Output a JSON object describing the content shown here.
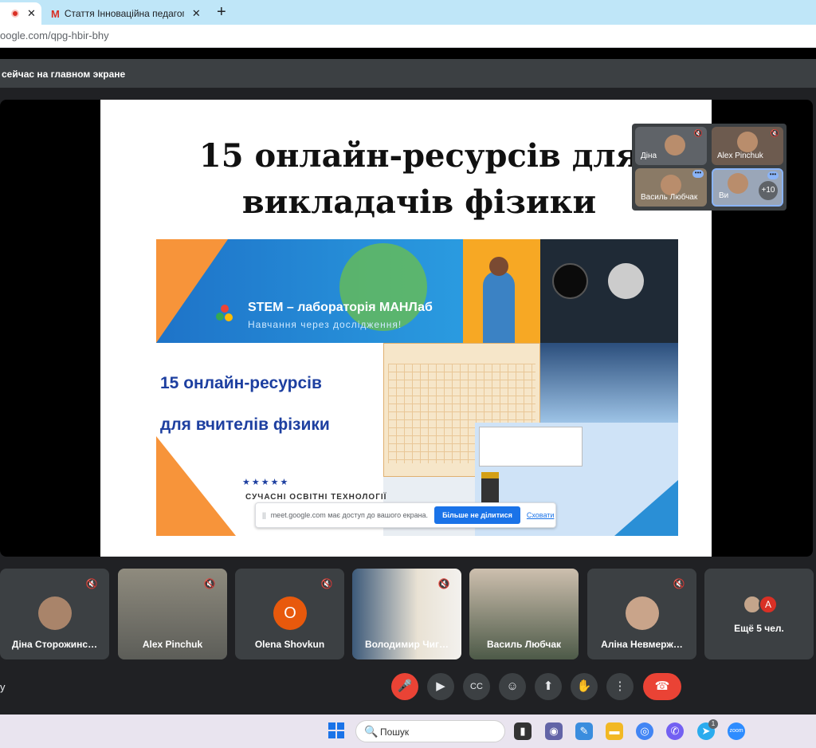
{
  "browser": {
    "tabs": [
      {
        "label": "",
        "close": "✕",
        "recording": true
      },
      {
        "label": "Стаття Інноваційна педагогіка ·",
        "close": "✕",
        "icon": "gmail-icon"
      }
    ],
    "new_tab": "+",
    "url": "oogle.com/qpg-hbir-bhy"
  },
  "meet": {
    "presenting_banner": "сейчас на главном экране",
    "slide": {
      "title_line1": "15 онлайн-ресурсів для",
      "title_line2": "викладачів фізики",
      "stem_title": "STEM – лабораторія МАНЛаб",
      "stem_subtitle": "Навчання через дослідження!",
      "big_line1": "15 онлайн-ресурсів",
      "big_line2": "для вчителів фізики",
      "edu_footer": "СУЧАСНІ ОСВІТНІ ТЕХНОЛОГІЇ",
      "stars": "★★★★★"
    },
    "share_notice": {
      "text": "meet.google.com має доступ до вашого екрана.",
      "stop_button": "Більше не ділитися",
      "hide_link": "Сховати"
    },
    "pip_tiles": [
      {
        "name": "Діна",
        "muted": true
      },
      {
        "name": "Alex Pinchuk",
        "muted": true
      },
      {
        "name": "Василь Любчак",
        "more": true
      },
      {
        "name": "Ви",
        "more": true,
        "extra": "+10"
      }
    ],
    "participants": [
      {
        "name": "Діна Сторожинс…",
        "type": "avatar",
        "muted": true
      },
      {
        "name": "Alex Pinchuk",
        "type": "video",
        "muted": true
      },
      {
        "name": "Olena Shovkun",
        "type": "letter",
        "letter": "O",
        "muted": true
      },
      {
        "name": "Володимир Чиг…",
        "type": "video",
        "muted": true
      },
      {
        "name": "Василь Любчак",
        "type": "video",
        "muted": false
      },
      {
        "name": "Аліна Невмерж…",
        "type": "avatar",
        "muted": true
      },
      {
        "name": "Ещё 5 чел.",
        "type": "more",
        "letter": "A"
      }
    ],
    "controls": {
      "side_label": "y",
      "mic": "🎤",
      "camera": "▶",
      "captions": "CC",
      "emoji": "☺",
      "present": "⬆",
      "hand": "✋",
      "more": "⋮",
      "end": "☎"
    }
  },
  "taskbar": {
    "search_placeholder": "Пошук",
    "telegram_badge": "1",
    "zoom_label": "zoom"
  },
  "colors": {
    "meet_bg": "#202124",
    "tile_bg": "#3c4043",
    "danger": "#ea4335",
    "accent": "#1a73e8"
  }
}
